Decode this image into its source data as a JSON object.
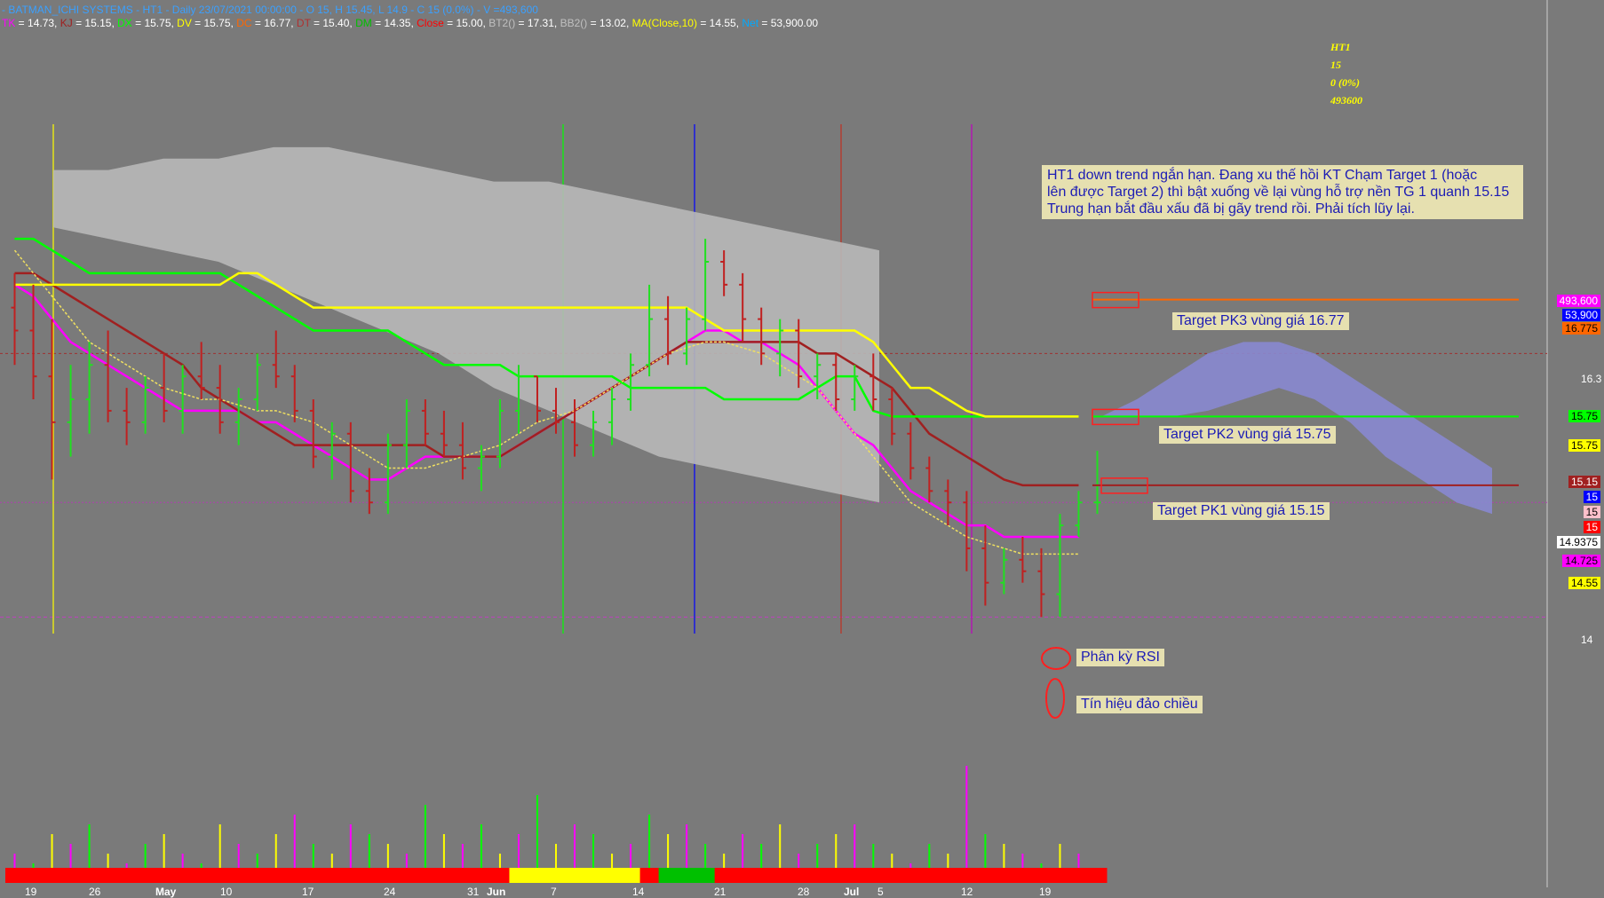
{
  "header": {
    "line1": "- BATMAN_ICHI SYSTEMS - HT1 - Daily 23/07/2021 00:00:00 - O 15, H 15.45, L 14.9 - C 15 (0.0%) - V =493,600",
    "indicators": [
      {
        "name": "TK",
        "value": "14.73",
        "color": "#ff00ff"
      },
      {
        "name": "KJ",
        "value": "15.15",
        "color": "#a02020"
      },
      {
        "name": "DX",
        "value": "15.75",
        "color": "#00ff00"
      },
      {
        "name": "DV",
        "value": "15.75",
        "color": "#ffff00"
      },
      {
        "name": "DC",
        "value": "16.77",
        "color": "#ff6600"
      },
      {
        "name": "DT",
        "value": "15.40",
        "color": "#b03030"
      },
      {
        "name": "DM",
        "value": "14.35",
        "color": "#00c000"
      },
      {
        "name": "Close",
        "value": "15.00",
        "color": "#ff0000"
      },
      {
        "name": "BT2()",
        "value": "17.31",
        "color": "#c0c0c0"
      },
      {
        "name": "BB2()",
        "value": "13.02",
        "color": "#c0c0c0"
      },
      {
        "name": "MA(Close,10)",
        "value": "14.55",
        "color": "#ffff00"
      },
      {
        "name": "Net",
        "value": "53,900.00",
        "color": "#00aaff"
      }
    ]
  },
  "info": {
    "symbol": "HT1",
    "price": "15",
    "change": "0 (0%)",
    "volume": "493600"
  },
  "note": {
    "lines": [
      "HT1 down trend ngắn hạn. Đang xu thế hồi KT Chạm Target 1 (hoặc",
      "lên được Target 2) thì bật xuống về lại vùng hỗ trợ nền TG 1 quanh 15.15",
      "Trung hạn bắt đầu xấu đã bị gãy trend rồi. Phải tích lũy lại."
    ]
  },
  "targets": {
    "pk3": "Target PK3 vùng giá 16.77",
    "pk2": "Target PK2 vùng giá 15.75",
    "pk1": "Target PK1 vùng giá 15.15",
    "rsi": "Phân kỳ RSI",
    "reversal": "Tín hiệu đảo chiều"
  },
  "price_tags": [
    {
      "text": "493,600",
      "bg": "#ff00ff",
      "fg": "#ffffff"
    },
    {
      "text": "53,900",
      "bg": "#0000ff",
      "fg": "#ffffff"
    },
    {
      "text": "16.775",
      "bg": "#ff6600",
      "fg": "#000000"
    },
    {
      "text": "15.75",
      "bg": "#00ff00",
      "fg": "#000000"
    },
    {
      "text": "15.75",
      "bg": "#ffff00",
      "fg": "#000000"
    },
    {
      "text": "15.15",
      "bg": "#a02020",
      "fg": "#ffffff"
    },
    {
      "text": "15",
      "bg": "#0000ff",
      "fg": "#ffffff"
    },
    {
      "text": "15",
      "bg": "#ffc0cb",
      "fg": "#000000"
    },
    {
      "text": "15",
      "bg": "#ff0000",
      "fg": "#ffffff"
    },
    {
      "text": "14.9375",
      "bg": "#ffffff",
      "fg": "#000000"
    },
    {
      "text": "14.725",
      "bg": "#ff00ff",
      "fg": "#000000"
    },
    {
      "text": "14.55",
      "bg": "#ffff00",
      "fg": "#000000"
    }
  ],
  "axis_labels": [
    "16.3",
    "14"
  ],
  "chart_data": {
    "type": "line",
    "title": "",
    "y_ticks": [
      16.3,
      14
    ],
    "x_ticks": [
      "19",
      "26",
      "May",
      "10",
      "17",
      "24",
      "31",
      "Jun",
      "7",
      "14",
      "21",
      "28",
      "Jul",
      "5",
      "12",
      "19"
    ],
    "x_ticks_bold": [
      "May",
      "Jun",
      "Jul"
    ],
    "ylim": [
      13.5,
      18.3
    ],
    "candles": [
      {
        "o": 16.7,
        "h": 17.0,
        "l": 16.2,
        "c": 16.5
      },
      {
        "o": 16.5,
        "h": 16.9,
        "l": 15.9,
        "c": 16.1
      },
      {
        "o": 16.1,
        "h": 16.6,
        "l": 15.2,
        "c": 15.7
      },
      {
        "o": 15.7,
        "h": 16.2,
        "l": 15.4,
        "c": 15.9
      },
      {
        "o": 15.9,
        "h": 16.4,
        "l": 15.6,
        "c": 16.2
      },
      {
        "o": 16.2,
        "h": 16.5,
        "l": 15.7,
        "c": 15.8
      },
      {
        "o": 15.8,
        "h": 16.0,
        "l": 15.5,
        "c": 15.7
      },
      {
        "o": 15.7,
        "h": 16.1,
        "l": 15.6,
        "c": 16.0
      },
      {
        "o": 16.0,
        "h": 16.3,
        "l": 15.7,
        "c": 15.8
      },
      {
        "o": 15.8,
        "h": 16.2,
        "l": 15.6,
        "c": 16.1
      },
      {
        "o": 16.1,
        "h": 16.4,
        "l": 15.9,
        "c": 16.0
      },
      {
        "o": 16.0,
        "h": 16.2,
        "l": 15.6,
        "c": 15.7
      },
      {
        "o": 15.7,
        "h": 16.0,
        "l": 15.5,
        "c": 15.9
      },
      {
        "o": 15.9,
        "h": 16.3,
        "l": 15.8,
        "c": 16.2
      },
      {
        "o": 16.2,
        "h": 16.5,
        "l": 16.0,
        "c": 16.1
      },
      {
        "o": 16.1,
        "h": 16.2,
        "l": 15.7,
        "c": 15.8
      },
      {
        "o": 15.8,
        "h": 15.9,
        "l": 15.3,
        "c": 15.4
      },
      {
        "o": 15.4,
        "h": 15.7,
        "l": 15.2,
        "c": 15.6
      },
      {
        "o": 15.6,
        "h": 15.7,
        "l": 15.0,
        "c": 15.1
      },
      {
        "o": 15.1,
        "h": 15.3,
        "l": 14.9,
        "c": 15.0
      },
      {
        "o": 15.0,
        "h": 15.6,
        "l": 14.9,
        "c": 15.5
      },
      {
        "o": 15.5,
        "h": 15.9,
        "l": 15.3,
        "c": 15.8
      },
      {
        "o": 15.8,
        "h": 15.9,
        "l": 15.5,
        "c": 15.6
      },
      {
        "o": 15.6,
        "h": 15.8,
        "l": 15.4,
        "c": 15.5
      },
      {
        "o": 15.5,
        "h": 15.7,
        "l": 15.2,
        "c": 15.3
      },
      {
        "o": 15.3,
        "h": 15.5,
        "l": 15.1,
        "c": 15.4
      },
      {
        "o": 15.4,
        "h": 15.9,
        "l": 15.3,
        "c": 15.8
      },
      {
        "o": 15.8,
        "h": 16.2,
        "l": 15.6,
        "c": 16.1
      },
      {
        "o": 16.1,
        "h": 16.1,
        "l": 15.7,
        "c": 15.8
      },
      {
        "o": 15.8,
        "h": 16.0,
        "l": 15.6,
        "c": 15.7
      },
      {
        "o": 15.7,
        "h": 15.9,
        "l": 15.4,
        "c": 15.5
      },
      {
        "o": 15.5,
        "h": 15.8,
        "l": 15.4,
        "c": 15.7
      },
      {
        "o": 15.7,
        "h": 16.0,
        "l": 15.5,
        "c": 15.9
      },
      {
        "o": 15.9,
        "h": 16.3,
        "l": 15.8,
        "c": 16.2
      },
      {
        "o": 16.2,
        "h": 16.9,
        "l": 16.1,
        "c": 16.6
      },
      {
        "o": 16.6,
        "h": 16.8,
        "l": 16.2,
        "c": 16.3
      },
      {
        "o": 16.3,
        "h": 16.7,
        "l": 16.2,
        "c": 16.6
      },
      {
        "o": 16.6,
        "h": 17.3,
        "l": 16.5,
        "c": 17.1
      },
      {
        "o": 17.1,
        "h": 17.2,
        "l": 16.8,
        "c": 16.9
      },
      {
        "o": 16.9,
        "h": 17.0,
        "l": 16.4,
        "c": 16.6
      },
      {
        "o": 16.6,
        "h": 16.7,
        "l": 16.2,
        "c": 16.3
      },
      {
        "o": 16.3,
        "h": 16.6,
        "l": 16.1,
        "c": 16.5
      },
      {
        "o": 16.5,
        "h": 16.6,
        "l": 16.0,
        "c": 16.1
      },
      {
        "o": 16.1,
        "h": 16.3,
        "l": 15.9,
        "c": 16.2
      },
      {
        "o": 16.2,
        "h": 16.3,
        "l": 15.8,
        "c": 15.9
      },
      {
        "o": 15.9,
        "h": 16.2,
        "l": 15.8,
        "c": 16.1
      },
      {
        "o": 16.1,
        "h": 16.3,
        "l": 15.8,
        "c": 15.9
      },
      {
        "o": 15.9,
        "h": 16.0,
        "l": 15.5,
        "c": 15.6
      },
      {
        "o": 15.6,
        "h": 15.7,
        "l": 15.2,
        "c": 15.3
      },
      {
        "o": 15.3,
        "h": 15.4,
        "l": 15.0,
        "c": 15.1
      },
      {
        "o": 15.1,
        "h": 15.2,
        "l": 14.8,
        "c": 15.0
      },
      {
        "o": 15.0,
        "h": 15.1,
        "l": 14.4,
        "c": 14.6
      },
      {
        "o": 14.6,
        "h": 14.8,
        "l": 14.1,
        "c": 14.3
      },
      {
        "o": 14.3,
        "h": 14.6,
        "l": 14.2,
        "c": 14.5
      },
      {
        "o": 14.5,
        "h": 14.7,
        "l": 14.3,
        "c": 14.4
      },
      {
        "o": 14.4,
        "h": 14.6,
        "l": 14.0,
        "c": 14.2
      },
      {
        "o": 14.2,
        "h": 14.9,
        "l": 14.0,
        "c": 14.8
      },
      {
        "o": 14.8,
        "h": 15.1,
        "l": 14.7,
        "c": 15.0
      },
      {
        "o": 15.0,
        "h": 15.45,
        "l": 14.9,
        "c": 15.0
      }
    ],
    "series": [
      {
        "name": "TK",
        "color": "#ff00ff",
        "values": [
          16.9,
          16.8,
          16.6,
          16.4,
          16.3,
          16.2,
          16.1,
          16.0,
          15.9,
          15.8,
          15.8,
          15.8,
          15.8,
          15.7,
          15.7,
          15.6,
          15.5,
          15.4,
          15.3,
          15.2,
          15.2,
          15.3,
          15.4,
          15.4,
          15.4,
          15.4,
          15.4,
          15.5,
          15.6,
          15.7,
          15.8,
          15.9,
          16.0,
          16.1,
          16.2,
          16.3,
          16.4,
          16.5,
          16.5,
          16.4,
          16.4,
          16.3,
          16.2,
          16.0,
          15.8,
          15.6,
          15.5,
          15.3,
          15.1,
          15.0,
          14.9,
          14.8,
          14.8,
          14.7,
          14.7,
          14.7,
          14.7,
          14.7
        ]
      },
      {
        "name": "KJ",
        "color": "#a02020",
        "values": [
          17.0,
          17.0,
          16.9,
          16.8,
          16.7,
          16.6,
          16.5,
          16.4,
          16.3,
          16.2,
          16.0,
          15.9,
          15.8,
          15.7,
          15.6,
          15.5,
          15.5,
          15.5,
          15.5,
          15.5,
          15.5,
          15.5,
          15.5,
          15.4,
          15.4,
          15.4,
          15.4,
          15.5,
          15.6,
          15.7,
          15.8,
          15.9,
          16.0,
          16.1,
          16.2,
          16.3,
          16.4,
          16.4,
          16.4,
          16.4,
          16.4,
          16.4,
          16.4,
          16.3,
          16.3,
          16.2,
          16.1,
          16.0,
          15.8,
          15.6,
          15.5,
          15.4,
          15.3,
          15.2,
          15.15,
          15.15,
          15.15,
          15.15
        ]
      },
      {
        "name": "DX",
        "color": "#00ff00",
        "values": [
          17.3,
          17.3,
          17.2,
          17.1,
          17.0,
          17.0,
          17.0,
          17.0,
          17.0,
          17.0,
          17.0,
          17.0,
          16.9,
          16.8,
          16.7,
          16.6,
          16.5,
          16.5,
          16.5,
          16.5,
          16.5,
          16.4,
          16.3,
          16.2,
          16.2,
          16.2,
          16.2,
          16.1,
          16.1,
          16.1,
          16.1,
          16.1,
          16.1,
          16.0,
          16.0,
          16.0,
          16.0,
          16.0,
          15.9,
          15.9,
          15.9,
          15.9,
          15.9,
          16.0,
          16.1,
          16.1,
          15.8,
          15.75,
          15.75,
          15.75,
          15.75,
          15.75,
          15.75,
          15.75,
          15.75,
          15.75,
          15.75,
          15.75
        ]
      },
      {
        "name": "DV",
        "color": "#ffff00",
        "values": [
          16.9,
          16.9,
          16.9,
          16.9,
          16.9,
          16.9,
          16.9,
          16.9,
          16.9,
          16.9,
          16.9,
          16.9,
          17.0,
          17.0,
          16.9,
          16.8,
          16.7,
          16.7,
          16.7,
          16.7,
          16.7,
          16.7,
          16.7,
          16.7,
          16.7,
          16.7,
          16.7,
          16.7,
          16.7,
          16.7,
          16.7,
          16.7,
          16.7,
          16.7,
          16.7,
          16.7,
          16.7,
          16.6,
          16.5,
          16.5,
          16.5,
          16.5,
          16.5,
          16.5,
          16.5,
          16.5,
          16.4,
          16.2,
          16.0,
          16.0,
          15.9,
          15.8,
          15.75,
          15.75,
          15.75,
          15.75,
          15.75,
          15.75
        ]
      },
      {
        "name": "MA(Close,10)",
        "color": "#f0e060",
        "dashed": true,
        "values": [
          17.2,
          17.0,
          16.8,
          16.6,
          16.4,
          16.3,
          16.2,
          16.1,
          16.0,
          15.95,
          15.9,
          15.9,
          15.85,
          15.8,
          15.8,
          15.75,
          15.7,
          15.6,
          15.5,
          15.4,
          15.3,
          15.3,
          15.3,
          15.35,
          15.4,
          15.45,
          15.5,
          15.6,
          15.7,
          15.75,
          15.8,
          15.9,
          16.0,
          16.1,
          16.2,
          16.3,
          16.35,
          16.4,
          16.4,
          16.35,
          16.3,
          16.2,
          16.1,
          16.0,
          15.8,
          15.6,
          15.4,
          15.2,
          15.0,
          14.9,
          14.8,
          14.7,
          14.65,
          14.6,
          14.55,
          14.55,
          14.55,
          14.55
        ]
      }
    ],
    "volume": [
      3,
      2,
      5,
      4,
      6,
      3,
      2,
      4,
      5,
      3,
      2,
      6,
      4,
      3,
      5,
      7,
      4,
      3,
      6,
      5,
      4,
      3,
      8,
      5,
      4,
      6,
      3,
      5,
      9,
      4,
      6,
      5,
      3,
      4,
      7,
      5,
      6,
      4,
      3,
      5,
      4,
      6,
      3,
      4,
      5,
      6,
      4,
      3,
      2,
      4,
      3,
      12,
      5,
      4,
      3,
      2,
      4,
      3
    ],
    "targets": [
      16.77,
      15.75,
      15.15
    ]
  }
}
